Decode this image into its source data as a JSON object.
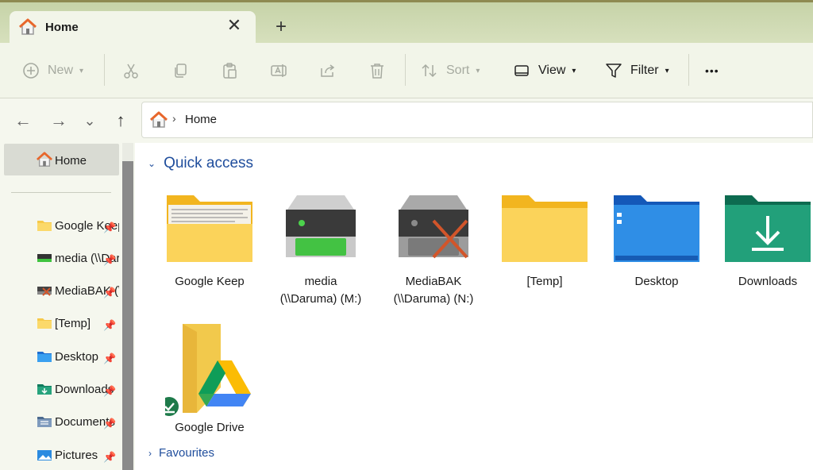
{
  "tab": {
    "title": "Home",
    "close_glyph": "✕",
    "new_tab_glyph": "+"
  },
  "toolbar": {
    "new_label": "New",
    "sort_label": "Sort",
    "view_label": "View",
    "filter_label": "Filter",
    "more_glyph": "•••"
  },
  "nav": {
    "back": "←",
    "forward": "→",
    "recent": "⌄",
    "up": "↑"
  },
  "address": {
    "path": "Home"
  },
  "sidebar": {
    "home": "Home",
    "items": [
      {
        "label": "Google Keep",
        "icon": "folder-icon"
      },
      {
        "label": "media (\\\\Daruma) (M:)",
        "icon": "network-drive-icon"
      },
      {
        "label": "MediaBAK (\\\\Daruma) (N:)",
        "icon": "disconnected-drive-icon"
      },
      {
        "label": "[Temp]",
        "icon": "folder-icon"
      },
      {
        "label": "Desktop",
        "icon": "desktop-folder-icon"
      },
      {
        "label": "Downloads",
        "icon": "downloads-folder-icon"
      },
      {
        "label": "Documents",
        "icon": "documents-folder-icon"
      },
      {
        "label": "Pictures",
        "icon": "pictures-folder-icon"
      }
    ]
  },
  "quick_access": {
    "title": "Quick access",
    "items": [
      {
        "line1": "Google Keep",
        "line2": ""
      },
      {
        "line1": "media",
        "line2": "(\\\\Daruma) (M:)"
      },
      {
        "line1": "MediaBAK",
        "line2": "(\\\\Daruma) (N:)"
      },
      {
        "line1": "[Temp]",
        "line2": ""
      },
      {
        "line1": "Desktop",
        "line2": ""
      },
      {
        "line1": "Downloads",
        "line2": ""
      },
      {
        "line1": "Google Drive",
        "line2": ""
      }
    ]
  },
  "favourites": {
    "title": "Favourites"
  },
  "colors": {
    "accent": "#1f4d9c",
    "folder": "#f6c94a",
    "drive_green": "#3fc33f",
    "error_red": "#d2552a"
  }
}
